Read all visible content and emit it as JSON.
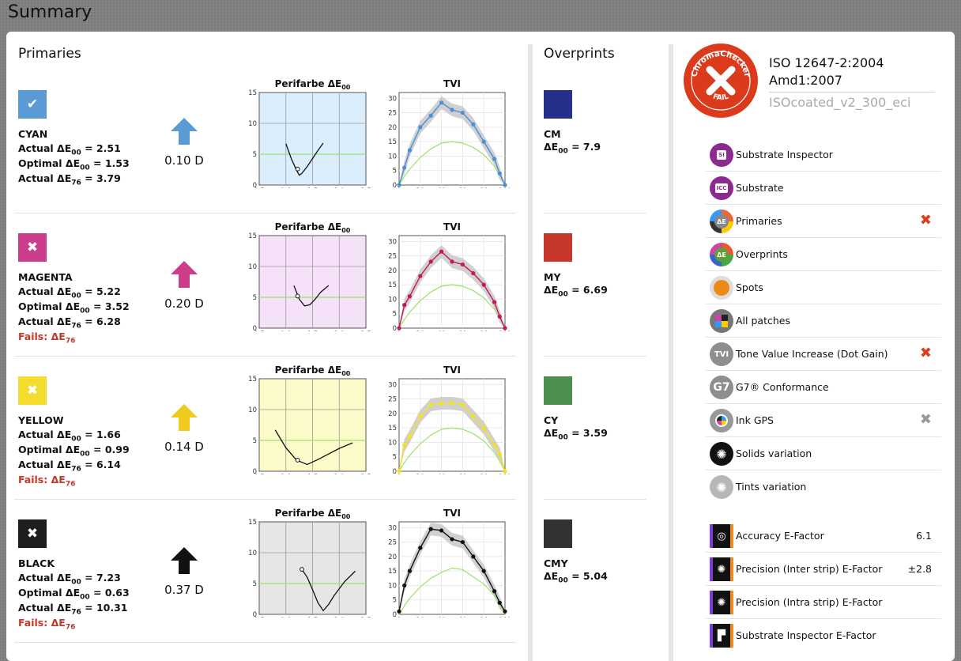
{
  "page": {
    "title": "Summary"
  },
  "primaries": {
    "title": "Primaries",
    "items": [
      {
        "name": "CYAN",
        "status": "pass",
        "swatch_color": "#5a9bd5",
        "arrow_color": "#5a9bd5",
        "status_mark": "✔",
        "actual_de00": "Actual ΔE00 = 2.51",
        "optimal_de00": "Optimal ΔE00 = 1.53",
        "actual_de76": "Actual ΔE76 = 3.79",
        "actual_de00_parts": [
          "Actual ΔE",
          "00",
          " = 2.51"
        ],
        "optimal_de00_parts": [
          "Optimal ΔE",
          "00",
          " = 1.53"
        ],
        "actual_de76_parts": [
          "Actual ΔE",
          "76",
          " = 3.79"
        ],
        "fails": null,
        "density": "0.10 D",
        "chart_bg": "#dbeefd",
        "tvi_color": "#4a90d9"
      },
      {
        "name": "MAGENTA",
        "status": "fail",
        "swatch_color": "#cc3d8a",
        "arrow_color": "#cc3d8a",
        "status_mark": "✖",
        "actual_de00_parts": [
          "Actual ΔE",
          "00",
          " = 5.22"
        ],
        "optimal_de00_parts": [
          "Optimal ΔE",
          "00",
          " = 3.52"
        ],
        "actual_de76_parts": [
          "Actual ΔE",
          "76",
          " = 6.28"
        ],
        "fails_parts": [
          "Fails: ΔE",
          "76"
        ],
        "density": "0.20 D",
        "chart_bg": "#f6e2f8",
        "tvi_color": "#c2185b"
      },
      {
        "name": "YELLOW",
        "status": "fail",
        "swatch_color": "#f4dc2e",
        "arrow_color": "#f0cb1d",
        "status_mark": "✖",
        "actual_de00_parts": [
          "Actual ΔE",
          "00",
          " = 1.66"
        ],
        "optimal_de00_parts": [
          "Optimal ΔE",
          "00",
          " = 0.99"
        ],
        "actual_de76_parts": [
          "Actual ΔE",
          "76",
          " = 6.14"
        ],
        "fails_parts": [
          "Fails: ΔE",
          "76"
        ],
        "density": "0.14 D",
        "chart_bg": "#fdfac9",
        "tvi_color": "#f5e21a"
      },
      {
        "name": "BLACK",
        "status": "fail",
        "swatch_color": "#1e1e1e",
        "arrow_color": "#111111",
        "status_mark": "✖",
        "actual_de00_parts": [
          "Actual ΔE",
          "00",
          " = 7.23"
        ],
        "optimal_de00_parts": [
          "Optimal ΔE",
          "00",
          " = 0.63"
        ],
        "actual_de76_parts": [
          "Actual ΔE",
          "76",
          " = 10.31"
        ],
        "fails_parts": [
          "Fails: ΔE",
          "76"
        ],
        "density": "0.37 D",
        "chart_bg": "#e6e6e6",
        "tvi_color": "#111111"
      }
    ]
  },
  "chart_data": [
    {
      "type": "line",
      "title": "Perifarbe ΔE00",
      "series_for": "CYAN",
      "x": [
        1.0,
        1.1,
        1.2,
        1.25,
        1.3,
        1.4,
        1.5,
        1.6,
        1.7
      ],
      "y": [
        6.7,
        4.3,
        2.4,
        1.6,
        1.9,
        3.0,
        4.3,
        5.6,
        6.8
      ],
      "marker": [
        1.22,
        2.6
      ],
      "reference_y": 5,
      "xlim": [
        0.5,
        2.5
      ],
      "ylim": [
        0,
        15
      ],
      "xticks": [
        "0.5",
        "1.0",
        "1.5",
        "2.0",
        "2.5"
      ],
      "yticks": [
        "0",
        "5",
        "10",
        "15"
      ]
    },
    {
      "type": "line",
      "title": "Perifarbe ΔE00",
      "series_for": "MAGENTA",
      "x": [
        1.15,
        1.25,
        1.35,
        1.45,
        1.55,
        1.65,
        1.8
      ],
      "y": [
        6.9,
        4.7,
        3.6,
        3.8,
        4.7,
        5.8,
        6.9
      ],
      "marker": [
        1.22,
        5.2
      ],
      "reference_y": 5,
      "xlim": [
        0.5,
        2.5
      ],
      "ylim": [
        0,
        15
      ],
      "xticks": [
        "0.5",
        "1.0",
        "1.5",
        "2.0",
        "2.5"
      ],
      "yticks": [
        "0",
        "5",
        "10",
        "15"
      ]
    },
    {
      "type": "line",
      "title": "Perifarbe ΔE00",
      "series_for": "YELLOW",
      "x": [
        0.8,
        1.0,
        1.2,
        1.4,
        1.6,
        1.8,
        2.0,
        2.25
      ],
      "y": [
        6.7,
        3.8,
        1.8,
        1.1,
        1.9,
        2.8,
        3.7,
        4.6
      ],
      "marker": [
        1.22,
        1.8
      ],
      "reference_y": 5,
      "xlim": [
        0.5,
        2.5
      ],
      "ylim": [
        0,
        15
      ],
      "xticks": [
        "0.5",
        "1.0",
        "1.5",
        "2.0",
        "2.5"
      ],
      "yticks": [
        "0",
        "5",
        "10",
        "15"
      ]
    },
    {
      "type": "line",
      "title": "Perifarbe ΔE00",
      "series_for": "BLACK",
      "x": [
        1.3,
        1.4,
        1.5,
        1.6,
        1.7,
        1.8,
        1.9,
        2.1,
        2.3
      ],
      "y": [
        7.3,
        6.0,
        4.0,
        1.9,
        0.6,
        1.6,
        3.0,
        5.3,
        7.0
      ],
      "marker": [
        1.3,
        7.3
      ],
      "reference_y": 5,
      "xlim": [
        0.5,
        2.5
      ],
      "ylim": [
        0,
        15
      ],
      "xticks": [
        "0.5",
        "1.0",
        "1.5",
        "2.0",
        "2.5"
      ],
      "yticks": [
        "0",
        "5",
        "10",
        "15"
      ]
    },
    {
      "type": "line",
      "title": "TVI",
      "series_for": "CYAN",
      "x": [
        0,
        5,
        10,
        20,
        30,
        40,
        50,
        60,
        70,
        80,
        90,
        95,
        100
      ],
      "y": [
        0,
        6,
        12,
        20,
        24,
        28.5,
        26,
        25,
        21,
        15,
        9,
        4,
        0
      ],
      "reference": [
        0,
        3,
        5.5,
        9.5,
        12.5,
        14.5,
        15,
        14.5,
        13,
        10.5,
        6.5,
        3.5,
        0
      ],
      "xlim": [
        0,
        100
      ],
      "ylim": [
        0,
        32
      ],
      "xticks": [
        "0",
        "20",
        "40",
        "60",
        "80",
        "100"
      ],
      "yticks": [
        "0",
        "5",
        "10",
        "15",
        "20",
        "25",
        "30"
      ]
    },
    {
      "type": "line",
      "title": "TVI",
      "series_for": "MAGENTA",
      "x": [
        0,
        5,
        10,
        20,
        30,
        40,
        50,
        60,
        70,
        80,
        90,
        95,
        100
      ],
      "y": [
        0,
        8,
        11,
        18,
        23,
        26.5,
        23,
        22,
        19,
        15,
        9,
        4,
        0
      ],
      "reference": [
        0,
        3,
        5.5,
        9.5,
        12.5,
        14.5,
        15,
        14.5,
        13,
        10.5,
        6.5,
        3.5,
        0
      ],
      "xlim": [
        0,
        100
      ],
      "ylim": [
        0,
        32
      ],
      "xticks": [
        "0",
        "20",
        "40",
        "60",
        "80",
        "100"
      ],
      "yticks": [
        "0",
        "5",
        "10",
        "15",
        "20",
        "25",
        "30"
      ]
    },
    {
      "type": "line",
      "title": "TVI",
      "series_for": "YELLOW",
      "x": [
        0,
        5,
        10,
        20,
        30,
        40,
        50,
        60,
        70,
        80,
        90,
        95,
        100
      ],
      "y": [
        0,
        9,
        12,
        19,
        23,
        23.5,
        23.5,
        23,
        19,
        15,
        9,
        6,
        0
      ],
      "reference": [
        0,
        3,
        5.5,
        9.5,
        12.5,
        14.5,
        15,
        14.5,
        13,
        10.5,
        6.5,
        3.5,
        0
      ],
      "xlim": [
        0,
        100
      ],
      "ylim": [
        0,
        32
      ],
      "xticks": [
        "0",
        "20",
        "40",
        "60",
        "80",
        "100"
      ],
      "yticks": [
        "0",
        "5",
        "10",
        "15",
        "20",
        "25",
        "30"
      ]
    },
    {
      "type": "line",
      "title": "TVI",
      "series_for": "BLACK",
      "x": [
        0,
        5,
        10,
        20,
        30,
        40,
        50,
        60,
        70,
        80,
        90,
        95,
        100
      ],
      "y": [
        1,
        10,
        15,
        23,
        29.5,
        29,
        26,
        25,
        20,
        15,
        8,
        4,
        1
      ],
      "reference": [
        0,
        3,
        5.5,
        9.5,
        12.5,
        14.5,
        16,
        15.5,
        13,
        10.5,
        6.5,
        3.5,
        0
      ],
      "xlim": [
        0,
        100
      ],
      "ylim": [
        0,
        32
      ],
      "xticks": [
        "0",
        "20",
        "40",
        "60",
        "80",
        "100"
      ],
      "yticks": [
        "0",
        "5",
        "10",
        "15",
        "20",
        "25",
        "30"
      ]
    }
  ],
  "overprints": {
    "title": "Overprints",
    "items": [
      {
        "name": "CM",
        "color": "#26308a",
        "de_parts": [
          "ΔE",
          "00",
          " = 7.9"
        ]
      },
      {
        "name": "MY",
        "color": "#c8372b",
        "de_parts": [
          "ΔE",
          "00",
          " = 6.69"
        ]
      },
      {
        "name": "CY",
        "color": "#4e8e4f",
        "de_parts": [
          "ΔE",
          "00",
          " = 3.59"
        ]
      },
      {
        "name": "CMY",
        "color": "#323232",
        "de_parts": [
          "ΔE",
          "00",
          " = 5.04"
        ]
      }
    ]
  },
  "standard": {
    "line1": "ISO 12647-2:2004",
    "line2": "Amd1:2007",
    "profile": "ISOcoated_v2_300_eci",
    "stamp_top": "ChromaChecker",
    "stamp_bottom": "FAIL",
    "stamp_color": "#dc3a1c"
  },
  "nav": {
    "items": [
      {
        "label": "Substrate Inspector",
        "icon": "substrate-inspector-icon",
        "glyph": "SI",
        "color": "#8b2b8f",
        "status": ""
      },
      {
        "label": "Substrate",
        "icon": "substrate-icon",
        "glyph": "ICC",
        "color": "#8b2b8f",
        "status": ""
      },
      {
        "label": "Primaries",
        "icon": "primaries-de-icon",
        "glyph": "ΔE",
        "color": "#7e7e7e",
        "status": "✖"
      },
      {
        "label": "Overprints",
        "icon": "overprints-de-icon",
        "glyph": "ΔE",
        "color": "#5f9e3a",
        "status": ""
      },
      {
        "label": "Spots",
        "icon": "spots-icon",
        "glyph": "",
        "color": "#ec8a19",
        "status": ""
      },
      {
        "label": "All patches",
        "icon": "all-patches-icon",
        "glyph": "",
        "color": "#7e7e7e",
        "status": ""
      },
      {
        "label": "Tone Value Increase (Dot Gain)",
        "icon": "tvi-icon",
        "glyph": "TVI",
        "color": "#8e8e8e",
        "status": "✖"
      },
      {
        "label": "G7® Conformance",
        "icon": "g7-icon",
        "glyph": "G7",
        "color": "#8e8e8e",
        "status": ""
      },
      {
        "label": "Ink GPS",
        "icon": "ink-gps-icon",
        "glyph": "",
        "color": "#8e8e8e",
        "status": "✖"
      },
      {
        "label": "Solids variation",
        "icon": "solids-variation-icon",
        "glyph": "",
        "color": "#111111",
        "status": ""
      },
      {
        "label": "Tints variation",
        "icon": "tints-variation-icon",
        "glyph": "",
        "color": "#b7b7b7",
        "status": ""
      }
    ],
    "efactors": [
      {
        "label": "Accuracy E-Factor",
        "icon": "accuracy-efactor-icon",
        "glyph": "◎",
        "value": "6.1"
      },
      {
        "label": "Precision (Inter strip) E-Factor",
        "icon": "precision-inter-efactor-icon",
        "glyph": "✺",
        "value": "±2.8"
      },
      {
        "label": "Precision (Intra strip) E-Factor",
        "icon": "precision-intra-efactor-icon",
        "glyph": "✺",
        "value": ""
      },
      {
        "label": "Substrate Inspector E-Factor",
        "icon": "substrate-inspector-efactor-icon",
        "glyph": "▛",
        "value": ""
      }
    ],
    "status_colors": {
      "fail": "#d9411e",
      "neutral": "#999999"
    }
  }
}
